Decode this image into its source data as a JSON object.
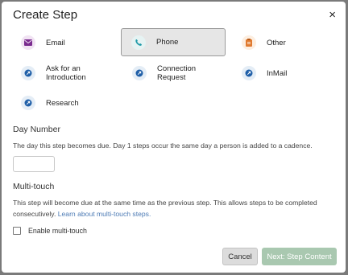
{
  "dialog": {
    "title": "Create Step",
    "close_symbol": "×"
  },
  "step_types": [
    {
      "label": "Email",
      "icon": "envelope-icon",
      "color": "#7a2b8f",
      "bg": "#f1e3f3",
      "selected": false
    },
    {
      "label": "Phone",
      "icon": "phone-icon",
      "color": "#1f9aa8",
      "bg": "#e6f3f3",
      "selected": true
    },
    {
      "label": "Other",
      "icon": "clipboard-icon",
      "color": "#e07a2f",
      "bg": "#fdeee0",
      "selected": false
    },
    {
      "label": "Ask for an Introduction",
      "icon": "linkedin-icon",
      "color": "#1f5fa8",
      "bg": "#e4edf6",
      "selected": false
    },
    {
      "label": "Connection Request",
      "icon": "linkedin-icon",
      "color": "#1f5fa8",
      "bg": "#e4edf6",
      "selected": false
    },
    {
      "label": "InMail",
      "icon": "linkedin-icon",
      "color": "#1f5fa8",
      "bg": "#e4edf6",
      "selected": false
    },
    {
      "label": "Research",
      "icon": "linkedin-icon",
      "color": "#1f5fa8",
      "bg": "#e4edf6",
      "selected": false
    }
  ],
  "day_number": {
    "label": "Day Number",
    "help": "The day this step becomes due. Day 1 steps occur the same day a person is added to a cadence.",
    "value": "",
    "placeholder": ""
  },
  "multi_touch": {
    "label": "Multi-touch",
    "help": "This step will become due at the same time as the previous step. This allows steps to be completed consecutively.",
    "link": "Learn about multi-touch steps.",
    "checkbox_label": "Enable multi-touch",
    "checked": false
  },
  "footer": {
    "cancel_label": "Cancel",
    "next_label": "Next: Step Content"
  },
  "colors": {
    "accent_disabled": "#a9c8b0",
    "link": "#4d7bb5"
  }
}
